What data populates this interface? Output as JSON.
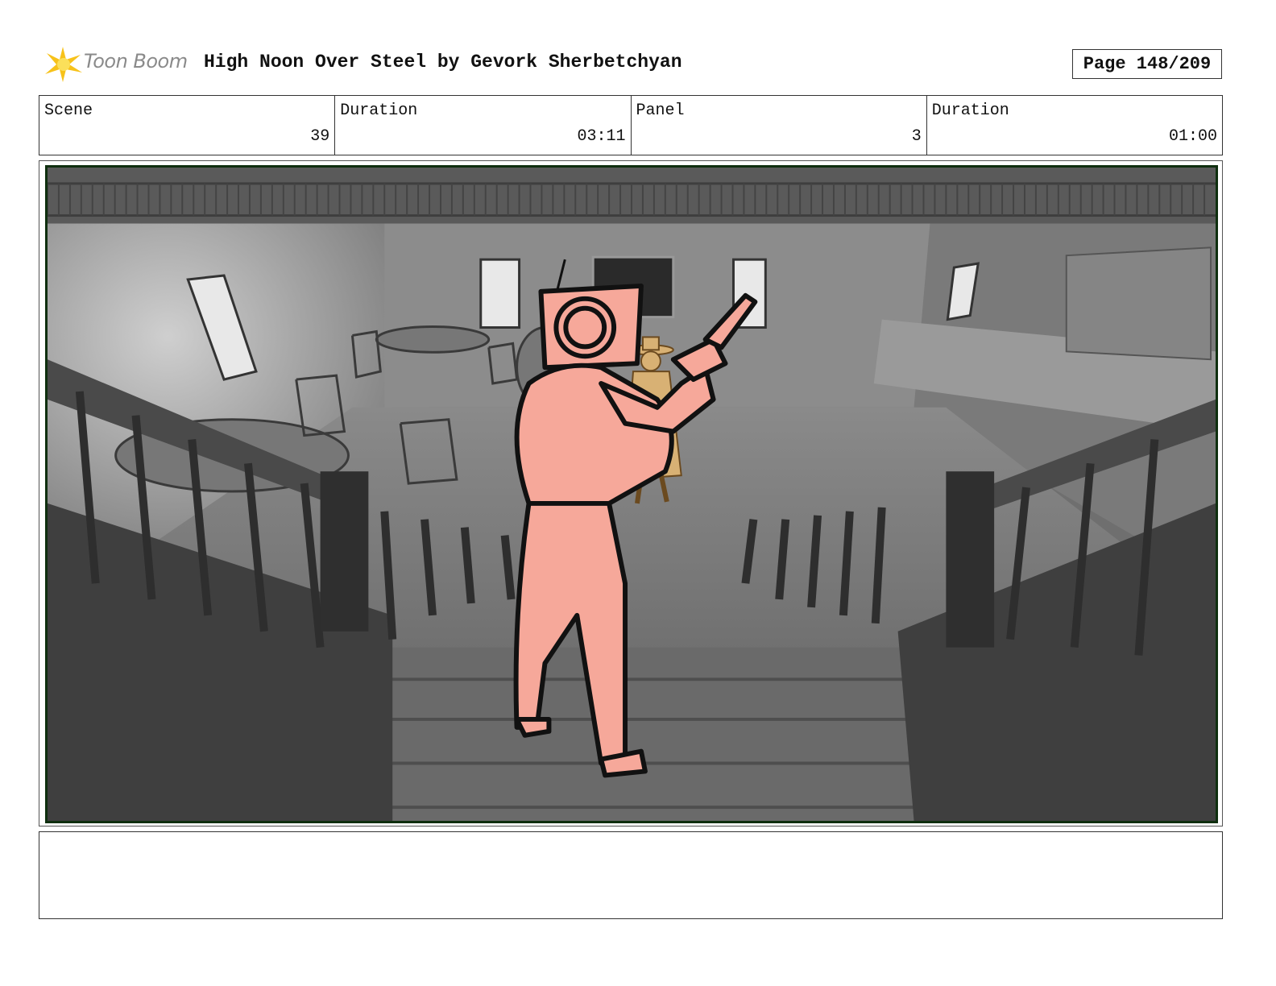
{
  "header": {
    "logo_text": "Toon Boom",
    "title": "High Noon Over Steel by Gevork Sherbetchyan",
    "page": "Page 148/209"
  },
  "info": {
    "scene_label": "Scene",
    "scene_value": "39",
    "scene_duration_label": "Duration",
    "scene_duration_value": "03:11",
    "panel_label": "Panel",
    "panel_value": "3",
    "panel_duration_label": "Duration",
    "panel_duration_value": "01:00"
  },
  "notes": {
    "text": ""
  },
  "colors": {
    "robot_fill": "#f6a89a",
    "cowboy_fill": "#d8b174",
    "frame_border": "#0f2f0f"
  }
}
